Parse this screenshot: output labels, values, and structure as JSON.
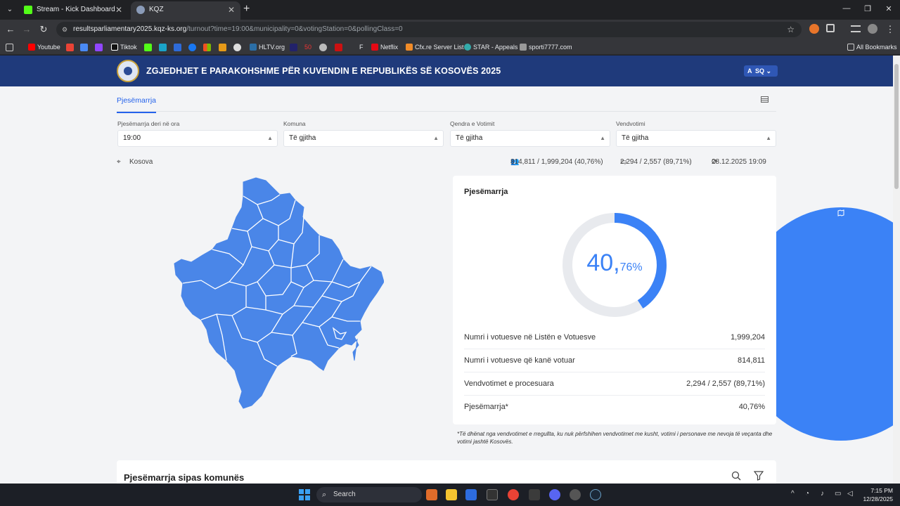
{
  "browser": {
    "tabs": [
      {
        "title": "Stream - Kick Dashboard",
        "active": false
      },
      {
        "title": "KQZ",
        "active": true
      }
    ],
    "url_host": "resultsparliamentary2025.kqz-ks.org",
    "url_path": "/turnout?time=19:00&municipality=0&votingStation=0&pollingClass=0",
    "bookmarks": [
      "Youtube",
      "Tiktok",
      "HLTV.org",
      "50",
      "F",
      "Netflix",
      "Cfx.re Server List",
      "STAR - Appeals",
      "sporti7777.com"
    ],
    "all_bookmarks": "All Bookmarks"
  },
  "header": {
    "title": "ZGJEDHJET E PARAKOHSHME PËR KUVENDIN E REPUBLIKËS SË KOSOVËS 2025",
    "lang": "SQ"
  },
  "subnav": {
    "tab": "Pjesëmarrja"
  },
  "filters": [
    {
      "label": "Pjesëmarrja deri në ora",
      "value": "19:00"
    },
    {
      "label": "Komuna",
      "value": "Të gjitha"
    },
    {
      "label": "Qendra e Votimit",
      "value": "Të gjitha"
    },
    {
      "label": "Vendvotimi",
      "value": "Të gjitha"
    }
  ],
  "stats": {
    "location": "Kosova",
    "voters": "814,811 / 1,999,204 (40,76%)",
    "stations": "2,294 / 2,557 (89,71%)",
    "updated": "28.12.2025 19:09"
  },
  "turnout_card": {
    "title": "Pjesëmarrja",
    "gauge_int": "40,",
    "gauge_dec": "76%",
    "gauge_fraction": 0.4076,
    "rows": [
      {
        "label": "Numri i votuesve në Listën e Votuesve",
        "value": "1,999,204"
      },
      {
        "label": "Numri i votuesve që kanë votuar",
        "value": "814,811"
      },
      {
        "label": "Vendvotimet e procesuara",
        "value": "2,294 / 2,557 (89,71%)"
      },
      {
        "label": "Pjesëmarrja*",
        "value": "40,76%"
      }
    ],
    "footnote": "*Të dhënat nga vendvotimet e rregullta, ku nuk përfshihen vendvotimet me kusht, votimi i personave me nevoja të veçanta dhe votimi jashtë Kosovës."
  },
  "municipality_card": {
    "title": "Pjesëmarrja sipas komunës"
  },
  "taskbar": {
    "search": "Search",
    "time": "7:15 PM",
    "date": "12/28/2025"
  },
  "colors": {
    "header": "#1f3a7b",
    "accent": "#3b82f6",
    "map": "#4a86e8"
  }
}
